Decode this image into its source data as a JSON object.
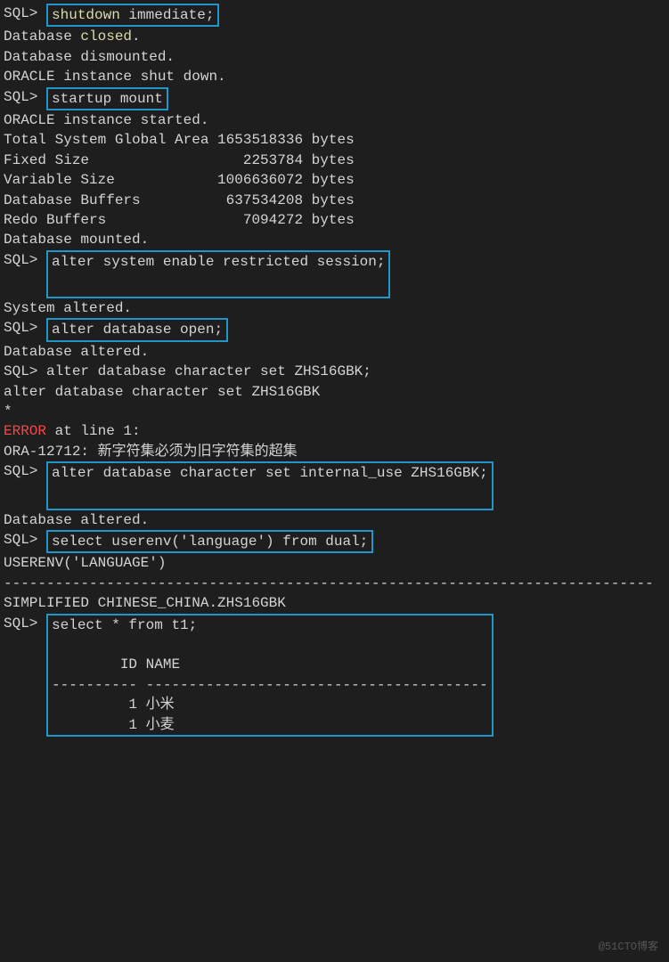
{
  "lines": {
    "l1_prompt": "SQL> ",
    "l1_cmd_hl": "shutdown",
    "l1_cmd_rest": " immediate;",
    "l2_a": "Database ",
    "l2_b": "closed",
    "l2_c": ".",
    "l3": "Database dismounted.",
    "l4": "ORACLE instance shut down.",
    "l5_prompt": "SQL> ",
    "l5_cmd": "startup mount",
    "l6": "ORACLE instance started.",
    "l7": "",
    "l8": "Total System Global Area 1653518336 bytes",
    "l9": "Fixed Size                  2253784 bytes",
    "l10": "Variable Size            1006636072 bytes",
    "l11": "Database Buffers          637534208 bytes",
    "l12": "Redo Buffers                7094272 bytes",
    "l13": "Database mounted.",
    "l14_prompt": "SQL> ",
    "l14_cmd": "alter system enable restricted session;",
    "l15": "",
    "l16": "System altered.",
    "l17": "",
    "l18_prompt": "SQL> ",
    "l18_cmd": "alter database open;",
    "l19": "",
    "l20": "Database altered.",
    "l21": "",
    "l22": "SQL> alter database character set ZHS16GBK;",
    "l23": "alter database character set ZHS16GBK",
    "l24": "*",
    "l25_a": "ERROR",
    "l25_b": " at line 1:",
    "l26": "ORA-12712: 新字符集必须为旧字符集的超集",
    "l27": "",
    "l28": "",
    "l29_prompt": "SQL> ",
    "l29_cmd": "alter database character set internal_use ZHS16GBK;",
    "l30": "",
    "l31": "Database altered.",
    "l32": "",
    "l33_prompt": "SQL> ",
    "l33_cmd": "select userenv('language') from dual;",
    "l34": "",
    "l35": "USERENV('LANGUAGE')",
    "l36": "----------------------------------------------------------------------------",
    "l37": "SIMPLIFIED CHINESE_CHINA.ZHS16GBK",
    "l38": "",
    "l39_prompt": "SQL> ",
    "l39_cmd": "select * from t1;",
    "l40": "",
    "l41": "        ID NAME",
    "l42": "---------- ----------------------------------------",
    "l43": "         1 小米",
    "l44": "         1 小麦"
  },
  "watermark": "@51CTO博客",
  "table_data": {
    "columns": [
      "ID",
      "NAME"
    ],
    "rows": [
      {
        "ID": 1,
        "NAME": "小米"
      },
      {
        "ID": 1,
        "NAME": "小麦"
      }
    ]
  }
}
